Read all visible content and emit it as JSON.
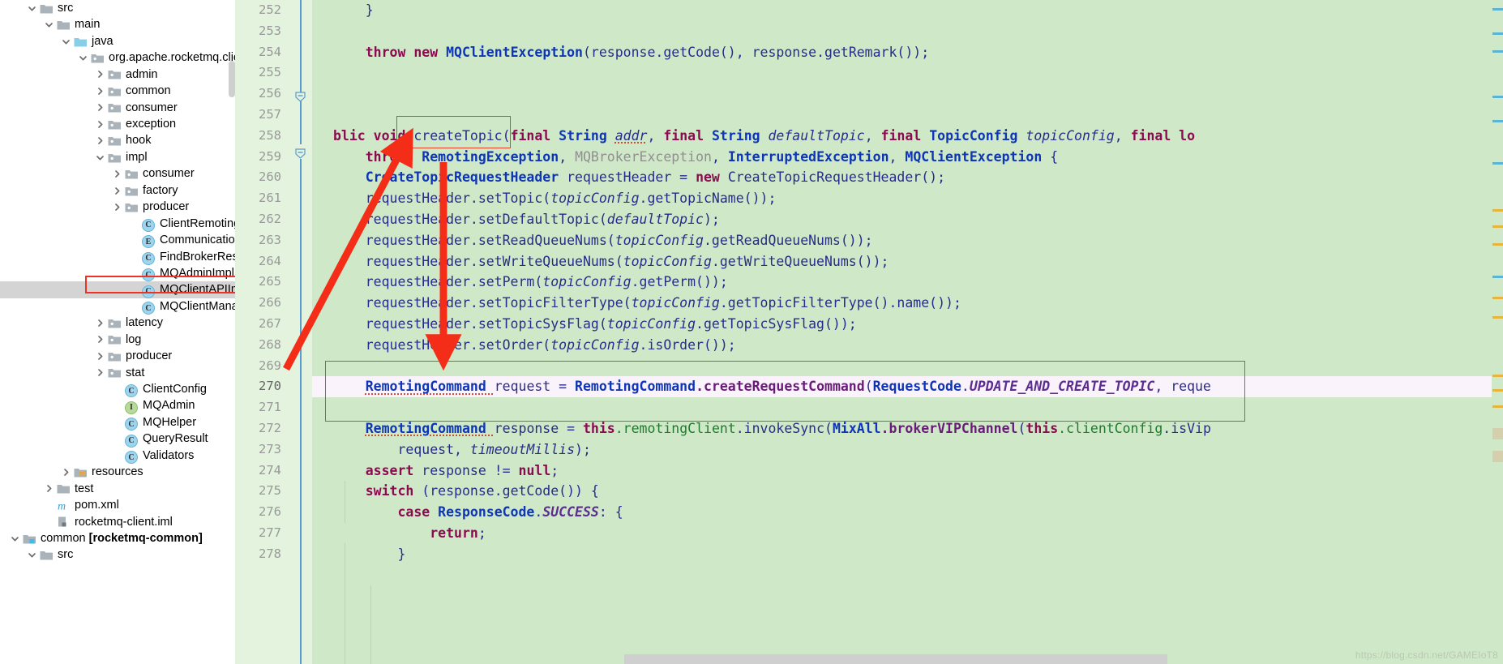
{
  "project_tree": {
    "name": "project-tool-window",
    "items": [
      {
        "label": "src",
        "indent": 1,
        "twisty": "down",
        "icon": "folder-src"
      },
      {
        "label": "main",
        "indent": 2,
        "twisty": "down",
        "icon": "folder-src"
      },
      {
        "label": "java",
        "indent": 3,
        "twisty": "down",
        "icon": "folder-java"
      },
      {
        "label": "org.apache.rocketmq.client",
        "indent": 4,
        "twisty": "down",
        "icon": "folder-package"
      },
      {
        "label": "admin",
        "indent": 5,
        "twisty": "right",
        "icon": "folder-package"
      },
      {
        "label": "common",
        "indent": 5,
        "twisty": "right",
        "icon": "folder-package"
      },
      {
        "label": "consumer",
        "indent": 5,
        "twisty": "right",
        "icon": "folder-package"
      },
      {
        "label": "exception",
        "indent": 5,
        "twisty": "right",
        "icon": "folder-package"
      },
      {
        "label": "hook",
        "indent": 5,
        "twisty": "right",
        "icon": "folder-package"
      },
      {
        "label": "impl",
        "indent": 5,
        "twisty": "down",
        "icon": "folder-package"
      },
      {
        "label": "consumer",
        "indent": 6,
        "twisty": "right",
        "icon": "folder-package"
      },
      {
        "label": "factory",
        "indent": 6,
        "twisty": "right",
        "icon": "folder-package"
      },
      {
        "label": "producer",
        "indent": 6,
        "twisty": "right",
        "icon": "folder-package"
      },
      {
        "label": "ClientRemotingProcessor",
        "indent": 7,
        "twisty": "none",
        "icon": "class"
      },
      {
        "label": "CommunicationMode",
        "indent": 7,
        "twisty": "none",
        "icon": "enum"
      },
      {
        "label": "FindBrokerResult",
        "indent": 7,
        "twisty": "none",
        "icon": "class"
      },
      {
        "label": "MQAdminImpl",
        "indent": 7,
        "twisty": "none",
        "icon": "class"
      },
      {
        "label": "MQClientAPIImpl",
        "indent": 7,
        "twisty": "none",
        "icon": "class",
        "selected": true
      },
      {
        "label": "MQClientManager",
        "indent": 7,
        "twisty": "none",
        "icon": "class"
      },
      {
        "label": "latency",
        "indent": 5,
        "twisty": "right",
        "icon": "folder-package"
      },
      {
        "label": "log",
        "indent": 5,
        "twisty": "right",
        "icon": "folder-package"
      },
      {
        "label": "producer",
        "indent": 5,
        "twisty": "right",
        "icon": "folder-package"
      },
      {
        "label": "stat",
        "indent": 5,
        "twisty": "right",
        "icon": "folder-package"
      },
      {
        "label": "ClientConfig",
        "indent": 6,
        "twisty": "none",
        "icon": "class"
      },
      {
        "label": "MQAdmin",
        "indent": 6,
        "twisty": "none",
        "icon": "interface"
      },
      {
        "label": "MQHelper",
        "indent": 6,
        "twisty": "none",
        "icon": "class"
      },
      {
        "label": "QueryResult",
        "indent": 6,
        "twisty": "none",
        "icon": "class"
      },
      {
        "label": "Validators",
        "indent": 6,
        "twisty": "none",
        "icon": "class"
      },
      {
        "label": "resources",
        "indent": 3,
        "twisty": "right",
        "icon": "folder-resources"
      },
      {
        "label": "test",
        "indent": 2,
        "twisty": "right",
        "icon": "folder-src"
      },
      {
        "label": "pom.xml",
        "indent": 2,
        "twisty": "none",
        "icon": "maven"
      },
      {
        "label": "rocketmq-client.iml",
        "indent": 2,
        "twisty": "none",
        "icon": "iml"
      },
      {
        "label": "common",
        "suffix": "[rocketmq-common]",
        "indent": 0,
        "twisty": "down",
        "icon": "module"
      },
      {
        "label": "src",
        "indent": 1,
        "twisty": "down",
        "icon": "folder-src"
      }
    ]
  },
  "editor": {
    "name": "code-editor",
    "first_line": 252,
    "current_line": 270,
    "lines": [
      {
        "n": 252,
        "html": "    }"
      },
      {
        "n": 253,
        "html": ""
      },
      {
        "n": 254,
        "html": "    <k>throw</k> <k>new</k> <t>MQClientException</t><p>(response.getCode(), response.getRemark());</p>"
      },
      {
        "n": 255,
        "html": ""
      },
      {
        "n": 256,
        "html": ""
      },
      {
        "n": 257,
        "html": ""
      },
      {
        "n": 258,
        "html": "<k>blic void </k><p>createTopic(</p><k>final </k><t>String </t><iw>addr</iw><p>, </p><k>final </k><t>String </t><i>defaultTopic</i><p>, </p><k>final </k><t>TopicConfig </t><i>topicConfig</i><p>, </p><k>final lo</k>"
      },
      {
        "n": 259,
        "html": "    <k>throws </k><t>RemotingException</t><p>, </p><g>MQBrokerException</g><p>, </p><t>InterruptedException</t><p>, </p><t>MQClientException </t><p>{</p>"
      },
      {
        "n": 260,
        "html": "    <t>CreateTopicRequestHeader </t><p>requestHeader = </p><k>new </k><p>CreateTopicRequestHeader();</p>"
      },
      {
        "n": 261,
        "html": "    <p>requestHeader.setTopic(</p><i>topicConfig</i><p>.getTopicName());</p>"
      },
      {
        "n": 262,
        "html": "    <p>requestHeader.setDefaultTopic(</p><i>defaultTopic</i><p>);</p>"
      },
      {
        "n": 263,
        "html": "    <p>requestHeader.setReadQueueNums(</p><i>topicConfig</i><p>.getReadQueueNums());</p>"
      },
      {
        "n": 264,
        "html": "    <p>requestHeader.setWriteQueueNums(</p><i>topicConfig</i><p>.getWriteQueueNums());</p>"
      },
      {
        "n": 265,
        "html": "    <p>requestHeader.setPerm(</p><i>topicConfig</i><p>.getPerm());</p>"
      },
      {
        "n": 266,
        "html": "    <p>requestHeader.setTopicFilterType(</p><i>topicConfig</i><p>.getTopicFilterType().name());</p>"
      },
      {
        "n": 267,
        "html": "    <p>requestHeader.setTopicSysFlag(</p><i>topicConfig</i><p>.getTopicSysFlag());</p>"
      },
      {
        "n": 268,
        "html": "    <p>requestHeader.setOrder(</p><i>topicConfig</i><p>.isOrder());</p>"
      },
      {
        "n": 269,
        "html": ""
      },
      {
        "n": 270,
        "html": "    <tw>RemotingCommand </tw><p>request = </p><t>RemotingCommand</t><f>.createRequestCommand</f><p>(</p><t>RequestCode</t><p>.</p><c>UPDATE_AND_CREATE_TOPIC</c><p>, reque</p>",
        "current": true
      },
      {
        "n": 271,
        "html": ""
      },
      {
        "n": 272,
        "html": "    <tw>RemotingCommand </tw><p>response = </p><k>this</k><gr>.remotingClient</gr><p>.invokeSync(</p><t>MixAll</t><f>.brokerVIPChannel</f><p>(</p><k>this</k><gr>.clientConfig</gr><p>.isVip</p>"
      },
      {
        "n": 273,
        "html": "        <p>request, </p><i>timeoutMillis</i><p>);</p>"
      },
      {
        "n": 274,
        "html": "    <k>assert </k><p>response != </p><k>null</k><p>;</p>"
      },
      {
        "n": 275,
        "html": "    <k>switch </k><p>(response.getCode()) {</p>"
      },
      {
        "n": 276,
        "html": "        <k>case </k><t>ResponseCode</t><p>.</p><c>SUCCESS</c><p>: {</p>"
      },
      {
        "n": 277,
        "html": "            <k>return</k><p>;</p>"
      },
      {
        "n": 278,
        "html": "        }"
      }
    ]
  },
  "annotations": {
    "name": "screenshot-annotations",
    "method_name_box": "createTopic",
    "highlight_box_lines": "269-271",
    "arrow": "red-arrow-pointing-to-createTopic",
    "sidebar_box": "MQClientAPIImpl"
  },
  "watermark": {
    "text": "https://blog.csdn.net/GAMEIoT8"
  }
}
